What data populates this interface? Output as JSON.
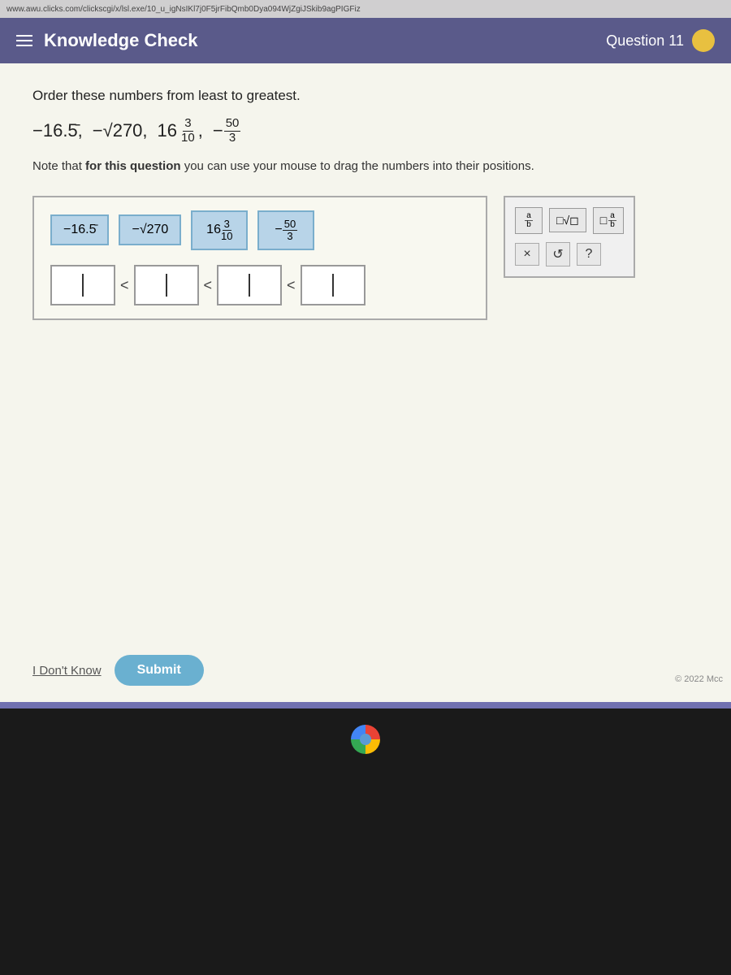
{
  "header": {
    "title": "Knowledge Check",
    "question_label": "Question 11"
  },
  "content": {
    "instruction": "Order these numbers from least to greatest.",
    "numbers": [
      "-16.5̄",
      "-√270",
      "16 3/10",
      "-50/3"
    ],
    "note": "Note that for this question you can use your mouse to drag the numbers into their positions.",
    "tiles": [
      {
        "label": "-16.5̄",
        "type": "text",
        "value": "-16.5̅"
      },
      {
        "label": "-√270",
        "type": "sqrt",
        "value": "-√270"
      },
      {
        "label": "16 3/10",
        "type": "mixed",
        "whole": "16",
        "numerator": "3",
        "denominator": "10"
      },
      {
        "label": "-50/3",
        "type": "fraction",
        "neg": "-",
        "numerator": "50",
        "denominator": "3"
      }
    ],
    "answer_slots": 4,
    "math_tools": {
      "fraction_label": "a/b",
      "sqrt_label": "√",
      "mixed_label": "□ a/b",
      "close_label": "×",
      "undo_label": "↺",
      "help_label": "?"
    }
  },
  "buttons": {
    "dont_know": "I Don't Know",
    "submit": "Submit"
  },
  "copyright": "© 2022 Mcc"
}
